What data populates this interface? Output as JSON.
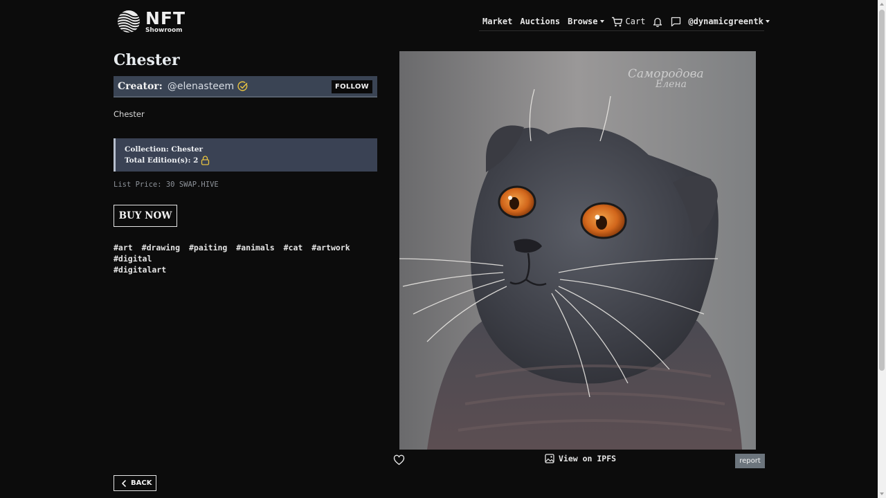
{
  "header": {
    "logo_text": "NFT",
    "logo_subtext": "Showroom",
    "nav": {
      "market": "Market",
      "auctions": "Auctions",
      "browse": "Browse",
      "cart": "Cart",
      "user": "@dynamicgreentk"
    }
  },
  "nft": {
    "title": "Chester",
    "creator_label": "Creator:",
    "creator_name": "@elenasteem",
    "follow_label": "FOLLOW",
    "description": "Chester",
    "collection_line": "Collection: Chester",
    "editions_line": "Total Edition(s): 2",
    "price_line": "List Price: 30 SWAP.HIVE",
    "buy_label": "BUY NOW",
    "tags": [
      "#art",
      "#drawing",
      "#paiting",
      "#animals",
      "#cat",
      "#artwork",
      "#digital",
      "#digitalart"
    ]
  },
  "image_actions": {
    "ipfs_label": "View on IPFS",
    "report_label": "report"
  },
  "back_label": "BACK",
  "icons": {
    "logo": "striped-globe-icon",
    "cart": "cart-icon",
    "bell": "bell-icon",
    "chat": "chat-icon",
    "verified": "verified-check-icon",
    "lock": "lock-icon",
    "heart": "heart-icon",
    "image": "image-icon",
    "back": "chevron-left-icon"
  },
  "colors": {
    "background": "#0c0c0c",
    "creator_bar": "#3a4454",
    "collection_box": "#3a4254",
    "verified_accent": "#e8c341",
    "lock_accent": "#e8c341",
    "report_button": "#6c757d"
  }
}
